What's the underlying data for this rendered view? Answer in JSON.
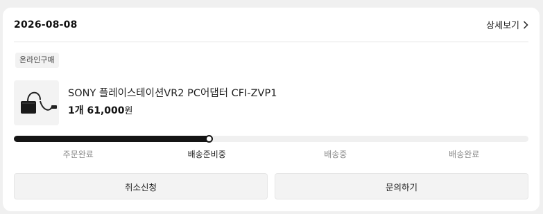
{
  "order": {
    "date": "2026-08-08",
    "detail_label": "상세보기"
  },
  "purchase_type": "온라인구매",
  "product": {
    "name": "SONY 플레이스테이션VR2 PC어댑터 CFI-ZVP1",
    "quantity": "1개",
    "price": "61,000",
    "currency_unit": "원",
    "thumbnail_icon": "pc-adapter-product-image"
  },
  "progress": {
    "current_step_index": 1,
    "fraction": 0.38,
    "steps": [
      "주문완료",
      "배송준비중",
      "배송중",
      "배송완료"
    ]
  },
  "actions": {
    "cancel_label": "취소신청",
    "inquiry_label": "문의하기"
  },
  "colors": {
    "accent": "#151515",
    "track": "#f0f0f0",
    "muted_text": "#8a8a8a"
  }
}
